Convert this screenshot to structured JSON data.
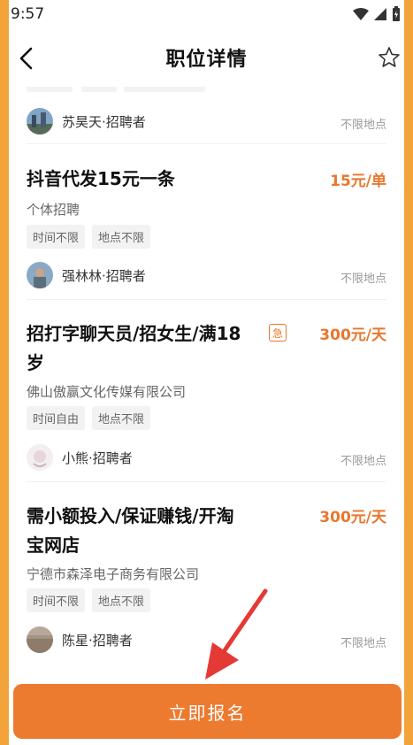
{
  "status_bar": {
    "time": "9:57"
  },
  "nav": {
    "title": "职位详情"
  },
  "jobs": [
    {
      "poster": "苏昊天·招聘者",
      "location": "不限地点"
    },
    {
      "title": "抖音代发15元一条",
      "salary": "15元/单",
      "company": "个体招聘",
      "tags": [
        "时间不限",
        "地点不限"
      ],
      "poster": "强林林·招聘者",
      "location": "不限地点"
    },
    {
      "title_line1": "招打字聊天员/招女生/满18",
      "title_line2": "岁",
      "urgent": "急",
      "salary": "300元/天",
      "company": "佛山傲赢文化传媒有限公司",
      "tags": [
        "时间自由",
        "地点不限"
      ],
      "poster": "小熊·招聘者",
      "location": "不限地点"
    },
    {
      "title_line1": "需小额投入/保证赚钱/开淘",
      "title_line2": "宝网店",
      "salary": "300元/天",
      "company": "宁德市森泽电子商务有限公司",
      "tags": [
        "时间不限",
        "地点不限"
      ],
      "poster": "陈星·招聘者",
      "location": "不限地点"
    }
  ],
  "apply_button": {
    "label": "立即报名"
  },
  "colors": {
    "accent": "#ec7a2f",
    "salary": "#e8772e",
    "frame": "#f2a33a"
  }
}
